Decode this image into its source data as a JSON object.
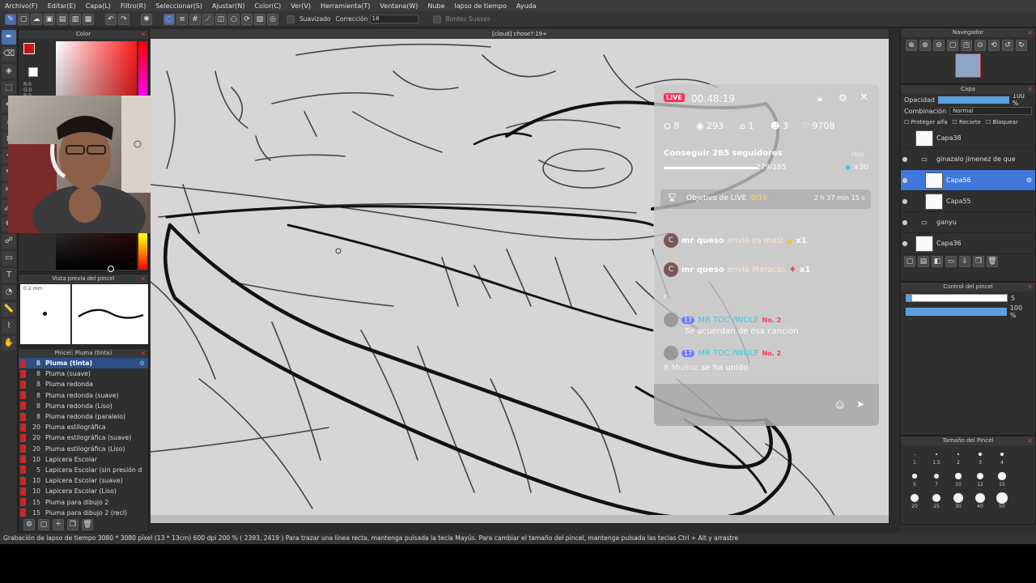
{
  "menu": [
    "Archivo(F)",
    "Editar(E)",
    "Capa(L)",
    "Filtro(R)",
    "Seleccionar(S)",
    "Ajustar(N)",
    "Color(C)",
    "Ver(V)",
    "Herramienta(T)",
    "Ventana(W)",
    "Nube",
    "lapso de tiempo",
    "Ayuda"
  ],
  "toolbar": {
    "suavizado": "Suavizado",
    "correccion_label": "Corrección",
    "correccion_value": "18",
    "bordes": "Bordes Suaves"
  },
  "document_tab": "[cloud] chose?:19+",
  "color_panel": {
    "title": "Color",
    "r": "R:0",
    "g": "G:0",
    "b": "B:0"
  },
  "brush_preview": {
    "title": "Vista previa del pincel",
    "size": "0.2 mm"
  },
  "brush_list": {
    "title": "Pincel: Pluma (tinta)",
    "items": [
      {
        "size": "8",
        "name": "Pluma (tinta)"
      },
      {
        "size": "8",
        "name": "Pluma (suave)"
      },
      {
        "size": "8",
        "name": "Pluma redonda"
      },
      {
        "size": "8",
        "name": "Pluma redonda (suave)"
      },
      {
        "size": "8",
        "name": "Pluma redonda (Liso)"
      },
      {
        "size": "8",
        "name": "Pluma redonda (paralelo)"
      },
      {
        "size": "20",
        "name": "Pluma estilográfica"
      },
      {
        "size": "20",
        "name": "Pluma estilográfica (suave)"
      },
      {
        "size": "20",
        "name": "Pluma estilográfica (Liso)"
      },
      {
        "size": "10",
        "name": "Lapicera Escolar"
      },
      {
        "size": "5",
        "name": "Lapicera Escolar (sin presión d"
      },
      {
        "size": "10",
        "name": "Lapicera Escolar (suave)"
      },
      {
        "size": "10",
        "name": "Lapicera Escolar (Liso)"
      },
      {
        "size": "15",
        "name": "Pluma para dibujo 2"
      },
      {
        "size": "15",
        "name": "Pluma para dibujo 2 (recl)"
      }
    ]
  },
  "live": {
    "badge": "LIVE",
    "timer": "00:48:19",
    "stats": {
      "members": "8",
      "views": "293",
      "gifts": "1",
      "users": "3",
      "likes": "9708"
    },
    "goal_title": "Conseguir 285 seguidores",
    "goal_day": "Hoy",
    "goal_progress": "279/285",
    "goal_progress_fraction": 0.98,
    "goal_reward": "×30",
    "objective": "Objetivo de LIVE",
    "objective_count": "0/16",
    "objective_time": "2 h 37 min 15 s",
    "chat": [
      {
        "avatar": "C",
        "user": "mr queso",
        "text": "envió es maíz",
        "mult": "x1"
      },
      {
        "avatar": "C",
        "user": "mr queso",
        "text": "envió Maracas",
        "mult": "x1"
      }
    ],
    "rmsg": "r",
    "mr_level": "17",
    "mr_user": "MR TOC /WOLF",
    "mr_rank": "No. 2",
    "mr_msg": "Se acuerdan de esa canción",
    "joined_user": "Muñoz",
    "joined_text": "se ha unido"
  },
  "navigator": {
    "title": "Navegador"
  },
  "layer_panel": {
    "title": "Capa",
    "opacity_label": "Opacidad",
    "opacity_value": "100 %",
    "opacity_fraction": 1.0,
    "blend_label": "Combinación",
    "blend_value": "Normal",
    "protect_alpha": "Proteger alfa",
    "clip": "Recorte",
    "lock": "Bloquear",
    "layers": [
      {
        "name": "Capa38",
        "type": "layer"
      },
      {
        "name": "ginazalo jimenez de que",
        "type": "folder"
      },
      {
        "name": "Capa56",
        "type": "layer",
        "selected": true
      },
      {
        "name": "Capa55",
        "type": "layer"
      },
      {
        "name": "ganyu",
        "type": "folder"
      },
      {
        "name": "Capa36",
        "type": "layer"
      }
    ]
  },
  "brush_control": {
    "title": "Control del pincel",
    "size_value": "5",
    "opacity_value": "100 %",
    "size_fraction": 0.06,
    "opacity_fraction": 1.0
  },
  "brush_size": {
    "title": "Tamaño del Pincel",
    "labels": [
      "1",
      "1.5",
      "2",
      "3",
      "4",
      "5",
      "7",
      "10",
      "12",
      "15",
      "20",
      "25",
      "30",
      "40",
      "50"
    ]
  },
  "status": "Grabación de lapso de tiempo   3080 * 3080 píxel  (13 * 13cm)   600 dpi   200 %   ( 2393, 2419 )   Para trazar una línea recta, mantenga pulsada la tecla Mayús. Para cambiar el tamaño del pincel, mantenga pulsada las teclas Ctrl + Alt y arrastre"
}
